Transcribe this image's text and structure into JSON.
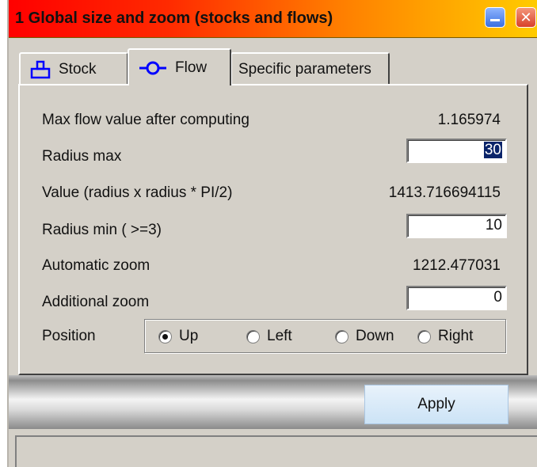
{
  "window": {
    "title": "1  Global size and zoom (stocks and flows)"
  },
  "tabs": [
    {
      "label": "Stock",
      "icon": "stock-icon"
    },
    {
      "label": "Flow",
      "icon": "flow-icon"
    },
    {
      "label": "Specific parameters"
    }
  ],
  "fields": {
    "max_flow_label": "Max flow value after computing",
    "max_flow_value": "1.165974",
    "radius_max_label": "Radius max",
    "radius_max_value": "30",
    "value_label": "Value (radius x radius * PI/2)",
    "value_value": "1413.716694115",
    "radius_min_label": "Radius min ( >=3)",
    "radius_min_value": "10",
    "auto_zoom_label": "Automatic zoom",
    "auto_zoom_value": "1212.477031",
    "additional_zoom_label": "Additional zoom",
    "additional_zoom_value": "0"
  },
  "position": {
    "label": "Position",
    "options": [
      "Up",
      "Left",
      "Down",
      "Right"
    ],
    "selected": "Up"
  },
  "apply": {
    "label": "Apply"
  },
  "colors": {
    "title_start": "#ff0000",
    "title_end": "#ffcc00",
    "icon_blue": "#0000ff",
    "selection": "#0a246a"
  }
}
